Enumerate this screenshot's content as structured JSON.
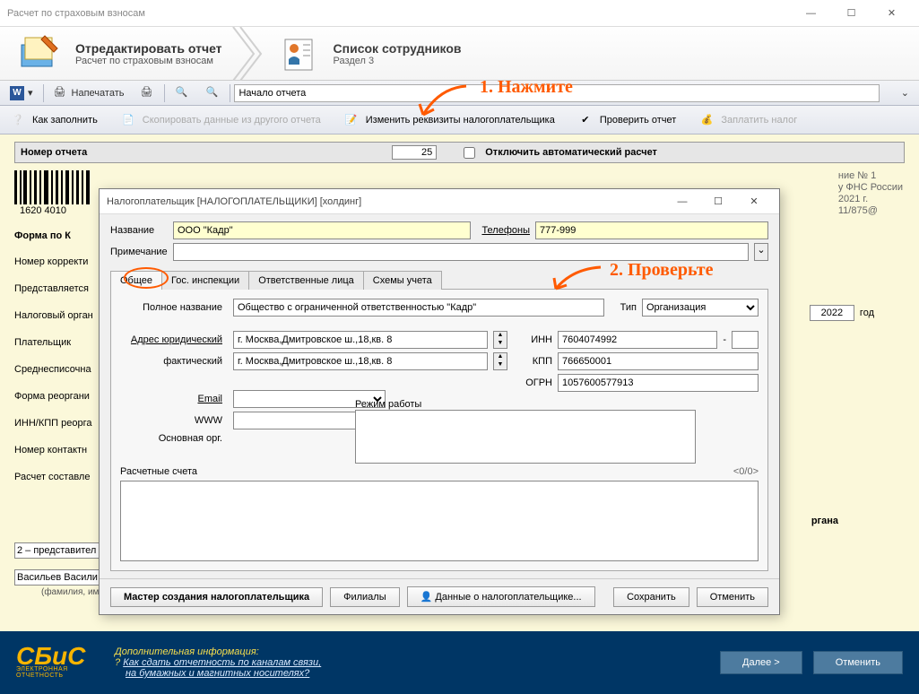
{
  "window": {
    "title": "Расчет по страховым взносам"
  },
  "wizard": {
    "step1_title": "Отредактировать отчет",
    "step1_sub": "Расчет по страховым взносам",
    "step2_title": "Список сотрудников",
    "step2_sub": "Раздел 3"
  },
  "toolbar1": {
    "print": "Напечатать",
    "start_section": "Начало отчета"
  },
  "toolbar2": {
    "howto": "Как заполнить",
    "copy": "Скопировать данные из другого отчета",
    "change_req": "Изменить реквизиты налогоплательщика",
    "check": "Проверить отчет",
    "pay": "Заплатить налог"
  },
  "report": {
    "num_label": "Номер отчета",
    "num_value": "25",
    "autocalc_off": "Отключить автоматический расчет",
    "form_label": "Форма по К",
    "year": "2022",
    "year_label": "год",
    "labels": [
      "Номер корректи",
      "Представляется",
      "Налоговый орган",
      "Плательщик",
      "Среднесписочна",
      "Форма реоргани",
      "ИНН/КПП реорга",
      "Номер контактн",
      "Расчет составле"
    ],
    "repr": "2 – представител",
    "fio": "Васильев Васили",
    "fio_note": "(фамилия, имя, отчество - полностью)",
    "org_tail": "ргана",
    "notes": [
      "ние № 1",
      "у ФНС России",
      "2021 г.",
      "11/875@"
    ]
  },
  "modal": {
    "title": "Налогоплательщик [НАЛОГОПЛАТЕЛЬЩИКИ] [холдинг]",
    "name_lab": "Название",
    "name_val": "ООО \"Кадр\"",
    "phones_lab": "Телефоны",
    "phones_val": "777-999",
    "note_lab": "Примечание",
    "tabs": [
      "Общее",
      "Гос. инспекции",
      "Ответственные лица",
      "Схемы учета"
    ],
    "full_name_lab": "Полное название",
    "full_name_val": "Общество с ограниченной ответственностью \"Кадр\"",
    "type_lab": "Тип",
    "type_val": "Организация",
    "addr_leg_lab": "Адрес  юридический",
    "addr_leg_val": "г. Москва,Дмитровское ш.,18,кв. 8",
    "addr_fact_lab": "фактический",
    "addr_fact_val": "г. Москва,Дмитровское ш.,18,кв. 8",
    "inn_lab": "ИНН",
    "inn_val": "7604074992",
    "kpp_lab": "КПП",
    "kpp_val": "766650001",
    "ogrn_lab": "ОГРН",
    "ogrn_val": "1057600577913",
    "email_lab": "Email",
    "www_lab": "WWW",
    "mainorg_lab": "Основная орг.",
    "schedule_lab": "Режим работы",
    "accounts_lab": "Расчетные счета",
    "accounts_count": "<0/0>",
    "btn_master": "Мастер создания налогоплательщика",
    "btn_branches": "Филиалы",
    "btn_taxdata": "Данные о налогоплательщике...",
    "btn_save": "Сохранить",
    "btn_cancel": "Отменить"
  },
  "footer": {
    "brand_top": "СБиС",
    "brand_sub": "ЭЛЕКТРОННАЯ ОТЧЕТНОСТЬ",
    "info_title": "Дополнительная информация:",
    "info_q": "Как сдать отчетность по каналам связи,",
    "info_q2": "на бумажных и магнитных носителях?",
    "next": "Далее >",
    "cancel": "Отменить"
  },
  "anno": {
    "a1": "1. Нажмите",
    "a2": "2. Проверьте"
  }
}
